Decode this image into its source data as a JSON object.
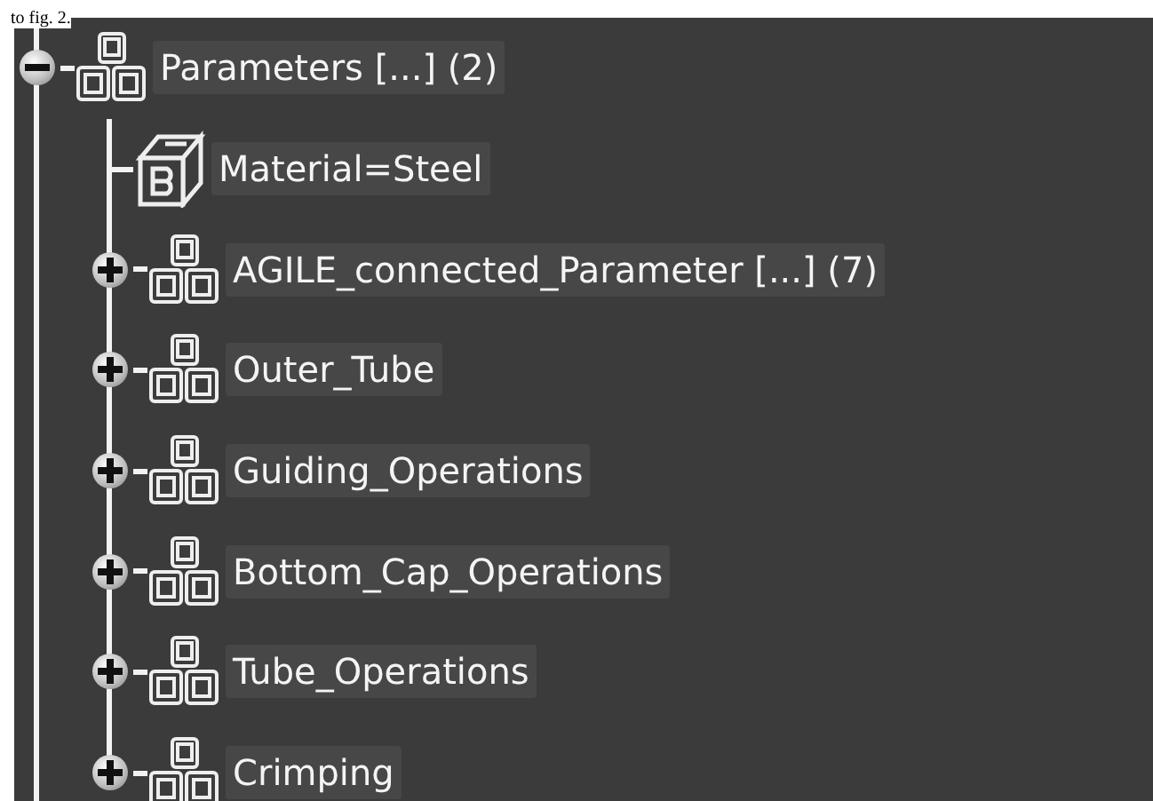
{
  "caption": "to fig. 2.",
  "tree": [
    {
      "label": "Parameters [...] (2)",
      "kind": "set",
      "expanded": true,
      "children": [
        {
          "label": "Material=Steel",
          "kind": "parameter"
        },
        {
          "label": "AGILE_connected_Parameter [...] (7)",
          "kind": "set",
          "expanded": false
        },
        {
          "label": "Outer_Tube",
          "kind": "set",
          "expanded": false
        },
        {
          "label": "Guiding_Operations",
          "kind": "set",
          "expanded": false
        },
        {
          "label": "Bottom_Cap_Operations",
          "kind": "set",
          "expanded": false
        },
        {
          "label": "Tube_Operations",
          "kind": "set",
          "expanded": false
        },
        {
          "label": "Crimping",
          "kind": "set",
          "expanded": false
        }
      ]
    }
  ]
}
